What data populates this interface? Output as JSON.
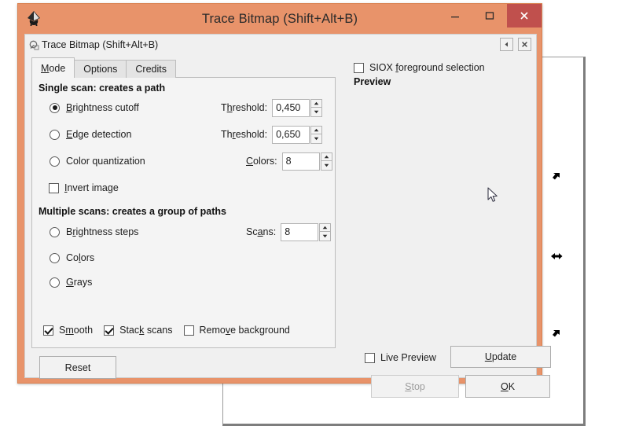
{
  "window": {
    "title": "Trace Bitmap (Shift+Alt+B)",
    "app_icon": "inkscape-logo-icon",
    "buttons": {
      "minimize": "minimize-icon",
      "maximize": "maximize-icon",
      "close": "close-icon"
    },
    "colors": {
      "titlebar": "#E8936A",
      "close_button": "#C0504D",
      "panel_background": "#F0F0F0",
      "page_background": "#F4F4F4"
    }
  },
  "panel": {
    "header_title": "Trace Bitmap (Shift+Alt+B)",
    "header_icon": "trace-bitmap-icon",
    "collapse_button": "collapse-left-icon",
    "close_button": "panel-close-icon"
  },
  "tabs": [
    {
      "label": "Mode",
      "mnemonic": "M",
      "active": true
    },
    {
      "label": "Options",
      "mnemonic": "O",
      "active": false
    },
    {
      "label": "Credits",
      "mnemonic": "C",
      "active": false
    }
  ],
  "single_scan": {
    "title": "Single scan: creates a path",
    "options": [
      {
        "label": "Brightness cutoff",
        "mnemonic_prefix": "B",
        "mnemonic_rest": "rightness cutoff",
        "selected": true
      },
      {
        "label": "Edge detection",
        "mnemonic_prefix": "E",
        "mnemonic_rest": "dge detection",
        "selected": false
      },
      {
        "label": "Color quantization",
        "mnemonic_prefix": "C",
        "mnemonic_rest": "olor quantization",
        "selected": false
      }
    ],
    "fields": [
      {
        "label_before": "T",
        "label_mnemonic": "h",
        "label_after": "reshold:",
        "value": "0,450"
      },
      {
        "label_before": "Th",
        "label_mnemonic": "r",
        "label_after": "eshold:",
        "value": "0,650"
      },
      {
        "label_before": "",
        "label_mnemonic": "C",
        "label_after": "olors:",
        "value": "8"
      }
    ],
    "invert_image": {
      "label_prefix": "I",
      "label_rest": "nvert image",
      "checked": false
    }
  },
  "multiple_scans": {
    "title": "Multiple scans: creates a group of paths",
    "options": [
      {
        "label_before": "B",
        "label_mnemonic": "r",
        "label_after": "ightness steps",
        "selected": false
      },
      {
        "label_before": "Co",
        "label_mnemonic": "l",
        "label_after": "ors",
        "selected": false
      },
      {
        "label_before": "",
        "label_mnemonic": "G",
        "label_after": "rays",
        "selected": false
      }
    ],
    "scans_field": {
      "label_before": "Sc",
      "label_mnemonic": "a",
      "label_after": "ns:",
      "value": "8"
    }
  },
  "bottom_checks": [
    {
      "label_before": "S",
      "label_mnemonic": "m",
      "label_after": "ooth",
      "checked": true
    },
    {
      "label_before": "Stac",
      "label_mnemonic": "k",
      "label_after": " scans",
      "checked": true
    },
    {
      "label_before": "Remo",
      "label_mnemonic": "v",
      "label_after": "e background",
      "checked": false
    }
  ],
  "reset_button": {
    "label": "Reset"
  },
  "right_column": {
    "siox": {
      "label_before": "SIOX ",
      "label_mnemonic": "f",
      "label_after": "oreground selection",
      "checked": false
    },
    "preview_title": "Preview",
    "live_preview": {
      "label": "Live Preview",
      "checked": false
    },
    "update_button": {
      "label_before": "",
      "label_mnemonic": "U",
      "label_after": "pdate",
      "enabled": true
    },
    "stop_button": {
      "label_before": "",
      "label_mnemonic": "S",
      "label_after": "top",
      "enabled": false
    },
    "ok_button": {
      "label_before": "",
      "label_mnemonic": "O",
      "label_after": "K",
      "enabled": true
    }
  },
  "canvas": {
    "selection_handles": [
      "rotate-handle-icon",
      "scale-handle-icon",
      "rotate-handle-icon"
    ],
    "cursor": "arrow-cursor"
  }
}
